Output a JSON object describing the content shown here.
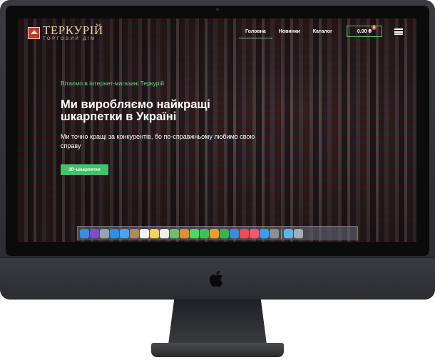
{
  "brand": {
    "name": "ТЕРКУРІЙ",
    "tagline": "ТОРГОВИЙ ДІМ"
  },
  "nav": [
    {
      "label": "Головна",
      "active": true
    },
    {
      "label": "Новинки",
      "active": false
    },
    {
      "label": "Каталог",
      "active": false
    }
  ],
  "cart": {
    "total": "0.00 ₴",
    "count": "0"
  },
  "hero": {
    "welcome": "Вітаємо в інтернет-магазині Теркурій",
    "headline": "Ми виробляємо найкращі шкарпетки в Україні",
    "subtext": "Ми точно кращі за конкурентів, бо по-справжньому любимо свою справу",
    "cta": "3D-шкарпетки"
  },
  "colors": {
    "accent": "#3fc36b",
    "accent_text": "#67d683",
    "brand_red": "#c0392b",
    "brand_gold": "#e6d2a8"
  },
  "dock": [
    {
      "name": "finder-icon",
      "color": "#3d8bd9"
    },
    {
      "name": "siri-icon",
      "color": "#7a4fc9"
    },
    {
      "name": "launchpad-icon",
      "color": "#9aa3ad"
    },
    {
      "name": "safari-icon",
      "color": "#2f8fe0"
    },
    {
      "name": "mail-icon",
      "color": "#4aa3f0"
    },
    {
      "name": "contacts-icon",
      "color": "#b08a5a"
    },
    {
      "name": "calendar-icon",
      "color": "#f2f2f2"
    },
    {
      "name": "notes-icon",
      "color": "#f3d35a"
    },
    {
      "name": "reminders-icon",
      "color": "#eeeeee"
    },
    {
      "name": "maps-icon",
      "color": "#6cbf6a"
    },
    {
      "name": "photos-icon",
      "color": "#e88a3c"
    },
    {
      "name": "messages-icon",
      "color": "#4cd964"
    },
    {
      "name": "facetime-icon",
      "color": "#3cc25a"
    },
    {
      "name": "pages-icon",
      "color": "#f39a2b"
    },
    {
      "name": "numbers-icon",
      "color": "#38b44a"
    },
    {
      "name": "keynote-icon",
      "color": "#3b8be0"
    },
    {
      "name": "news-icon",
      "color": "#f04a55"
    },
    {
      "name": "music-icon",
      "color": "#f5556d"
    },
    {
      "name": "appstore-icon",
      "color": "#3a9cf4"
    },
    {
      "name": "preferences-icon",
      "color": "#8a8f96"
    },
    {
      "name": "separator",
      "color": ""
    },
    {
      "name": "folder-icon",
      "color": "#5fb3e8"
    },
    {
      "name": "trash-icon",
      "color": "#a5adb5"
    }
  ]
}
